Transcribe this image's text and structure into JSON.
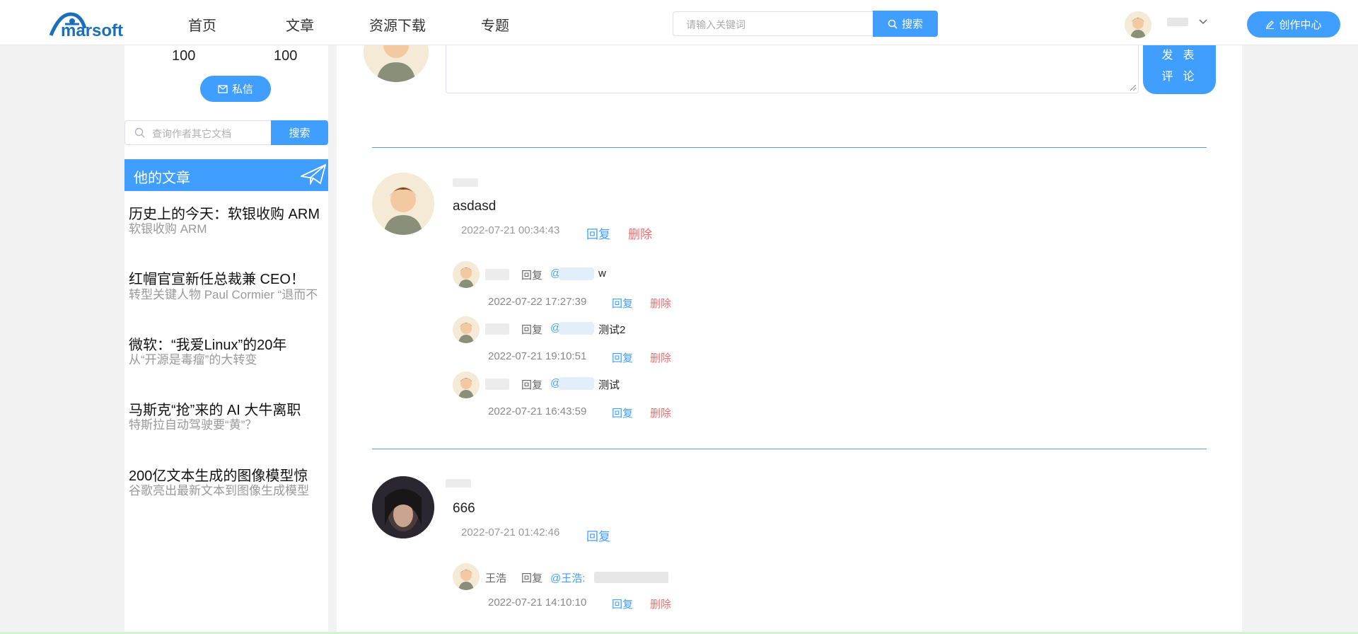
{
  "header": {
    "logo_text": "marsoft",
    "nav": [
      "首页",
      "文章",
      "资源下载",
      "专题"
    ],
    "search_placeholder": "请输入关键词",
    "search_button": "搜索",
    "create_button": "创作中心"
  },
  "profile": {
    "stats": [
      "100",
      "100"
    ],
    "message_button": "私信",
    "search_placeholder": "查询作者其它文档",
    "search_button": "搜索",
    "articles_header": "他的文章",
    "articles": [
      {
        "title": "历史上的今天：软银收购 ARM",
        "subtitle": "软银收购 ARM"
      },
      {
        "title": "红帽官宣新任总裁兼 CEO！",
        "subtitle": "转型关键人物 Paul Cormier “退而不"
      },
      {
        "title": "微软：“我爱Linux”的20年",
        "subtitle": "从“开源是毒瘤”的大转变"
      },
      {
        "title": "马斯克“抢”来的 AI 大牛离职",
        "subtitle": "特斯拉自动驾驶要“黄”？"
      },
      {
        "title": "200亿文本生成的图像模型惊",
        "subtitle": "谷歌亮出最新文本到图像生成模型"
      }
    ]
  },
  "comment_box": {
    "post_button_line1": "发表",
    "post_button_line2": "评论"
  },
  "comments": [
    {
      "text": "asdasd",
      "time": "2022-07-21 00:34:43",
      "reply_label": "回复",
      "delete_label": "删除",
      "replies": [
        {
          "reply_word": "回复",
          "mention": "@",
          "text": "w",
          "time": "2022-07-22 17:27:39",
          "reply_label": "回复",
          "delete_label": "删除"
        },
        {
          "reply_word": "回复",
          "mention": "@",
          "text": "测试2",
          "time": "2022-07-21 19:10:51",
          "reply_label": "回复",
          "delete_label": "删除"
        },
        {
          "reply_word": "回复",
          "mention": "@",
          "text": "测试",
          "time": "2022-07-21 16:43:59",
          "reply_label": "回复",
          "delete_label": "删除"
        }
      ]
    },
    {
      "text": "666",
      "time": "2022-07-21 01:42:46",
      "reply_label": "回复",
      "replies": [
        {
          "name": "王浩",
          "reply_word": "回复",
          "mention": "@王浩:",
          "time": "2022-07-21 14:10:10",
          "reply_label": "回复",
          "delete_label": "删除"
        }
      ]
    }
  ],
  "colors": {
    "accent": "#409eff",
    "danger": "#f56c6c",
    "divider": "#5b9bd5"
  }
}
